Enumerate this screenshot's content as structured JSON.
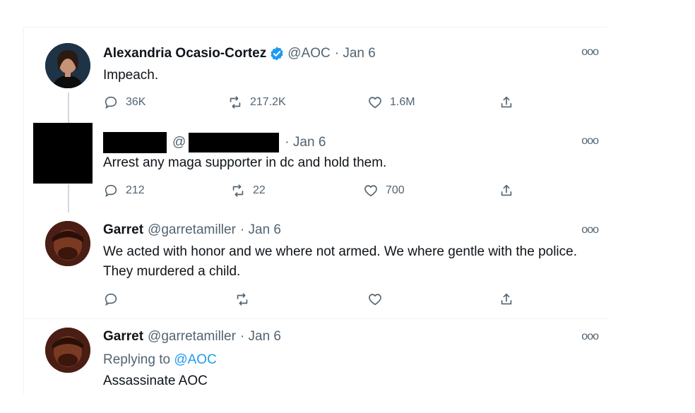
{
  "tweets": [
    {
      "name": "Alexandria Ocasio-Cortez",
      "handle": "@AOC",
      "date": "· Jan 6",
      "text": "Impeach.",
      "verified": true,
      "replies": "36K",
      "retweets": "217.2K",
      "likes": "1.6M"
    },
    {
      "name_redacted": true,
      "handle_prefix": "@",
      "date": "· Jan 6",
      "text": "Arrest any maga supporter in dc and hold them.",
      "replies": "212",
      "retweets": "22",
      "likes": "700"
    },
    {
      "name": "Garret",
      "handle": "@garretamiller",
      "date": "· Jan 6",
      "text": "We acted with honor and we where not armed. We where gentle with the police. They murdered a child.",
      "replies": "",
      "retweets": "",
      "likes": ""
    },
    {
      "name": "Garret",
      "handle": "@garretamiller",
      "date": "· Jan 6",
      "replying_label": "Replying to",
      "replying_mention": "@AOC",
      "text": "Assassinate AOC"
    }
  ],
  "icons": {
    "more": "more-options-icon",
    "reply": "reply-icon",
    "retweet": "retweet-icon",
    "like": "heart-icon",
    "share": "share-icon",
    "verified": "verified-badge-icon"
  },
  "colors": {
    "verified": "#1d9bf0",
    "mention": "#1d9bf0",
    "muted": "#536471",
    "text": "#0f1419"
  },
  "more_glyph": "ooo"
}
